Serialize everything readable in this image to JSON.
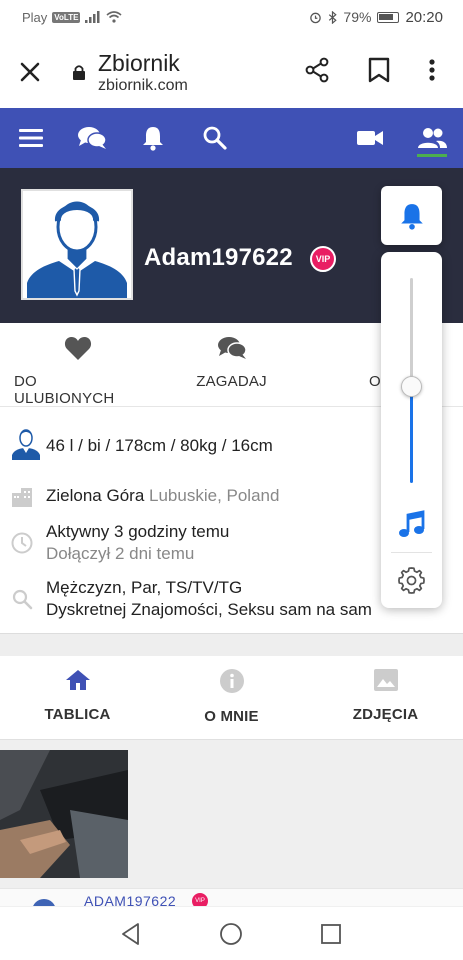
{
  "status_bar": {
    "carrier": "Play",
    "volte": "VoLTE",
    "battery": "79%",
    "time": "20:20"
  },
  "browser": {
    "title": "Zbiornik",
    "url": "zbiornik.com"
  },
  "site_nav": {
    "icons": [
      "menu-icon",
      "chat-icon",
      "bell-icon",
      "search-icon",
      "video-camera-icon",
      "users-icon"
    ],
    "active": "users-icon",
    "colors": {
      "bar": "#3f51b5",
      "active_underline": "#4caf50"
    }
  },
  "profile": {
    "username": "Adam197622",
    "vip_label": "VIP"
  },
  "actions": [
    {
      "label": "DO ULUBIONYCH",
      "icon": "heart-icon"
    },
    {
      "label": "ZAGADAJ",
      "icon": "chat-icon"
    },
    {
      "label": "OP",
      "icon": "more-actions-icon"
    }
  ],
  "info": {
    "stats": "46 l / bi / 178cm / 80kg / 16cm",
    "city": "Zielona Góra",
    "region": "Lubuskie, Poland",
    "active": "Aktywny 3 godziny temu",
    "joined": "Dołączył 2 dni temu",
    "looking_for": "Mężczyzn, Par, TS/TV/TG",
    "interests": "Dyskretnej Znajomości, Seksu sam na sam"
  },
  "tabs": [
    {
      "label": "TABLICA",
      "icon": "home-icon",
      "active": true
    },
    {
      "label": "O MNIE",
      "icon": "info-icon",
      "active": false
    },
    {
      "label": "ZDJĘCIA",
      "icon": "image-icon",
      "active": false
    }
  ],
  "post": {
    "author": "ADAM197622",
    "vip_label": "VIP"
  },
  "media_panel": {
    "volume_level_pct": 50,
    "accent": "#1a73e8"
  }
}
